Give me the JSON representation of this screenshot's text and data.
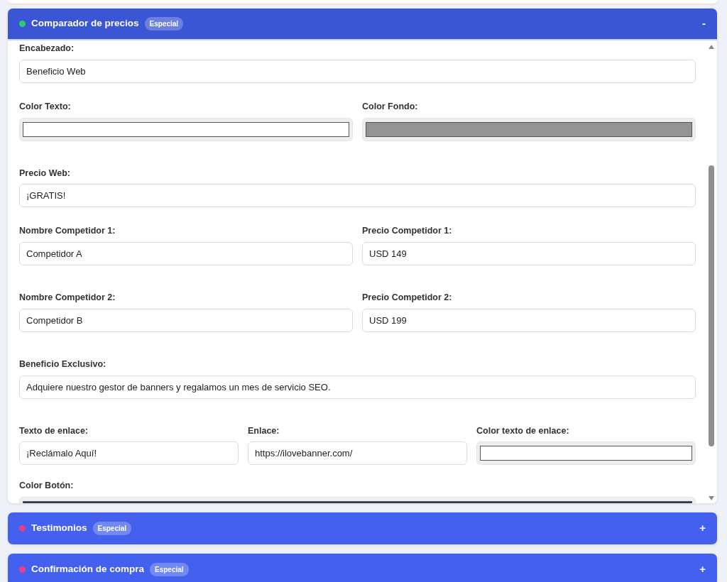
{
  "panels": [
    {
      "title": "Comparador de precios",
      "badge": "Especial",
      "color": "#2ecc71",
      "expanded": true,
      "toggle": "-",
      "rows": [
        [
          {
            "label": "Encabezado:",
            "kind": "text",
            "value": "Beneficio Web"
          }
        ],
        [
          {
            "label": "Color Texto:",
            "kind": "color",
            "color": "#ffffff"
          },
          {
            "label": "Color Fondo:",
            "kind": "color",
            "color": "#949494"
          }
        ],
        [
          {
            "label": "Precio Web:",
            "kind": "text",
            "value": "¡GRATIS!"
          }
        ],
        [
          {
            "label": "Nombre Competidor 1:",
            "kind": "text",
            "value": "Competidor A"
          },
          {
            "label": "Precio Competidor 1:",
            "kind": "text",
            "value": "USD 149"
          }
        ],
        [
          {
            "label": "Nombre Competidor 2:",
            "kind": "text",
            "value": "Competidor B"
          },
          {
            "label": "Precio Competidor 2:",
            "kind": "text",
            "value": "USD 199"
          }
        ],
        [
          {
            "label": "Beneficio Exclusivo:",
            "kind": "text",
            "value": "Adquiere nuestro gestor de banners y regalamos un mes de servicio SEO."
          }
        ],
        [
          {
            "label": "Texto de enlace:",
            "kind": "text",
            "value": "¡Reclámalo Aquí!"
          },
          {
            "label": "Enlace:",
            "kind": "text",
            "value": "https://ilovebanner.com/"
          },
          {
            "label": "Color texto de enlace:",
            "kind": "color",
            "color": "#ffffff"
          }
        ],
        [
          {
            "label": "Color Botón:",
            "kind": "color",
            "color": "#333a44"
          }
        ]
      ]
    },
    {
      "title": "Testimonios",
      "badge": "Especial",
      "color": "#e83e8c",
      "expanded": false,
      "toggle": "+"
    },
    {
      "title": "Confirmación de compra",
      "badge": "Especial",
      "color": "#e83e8c",
      "expanded": false,
      "toggle": "+"
    }
  ]
}
